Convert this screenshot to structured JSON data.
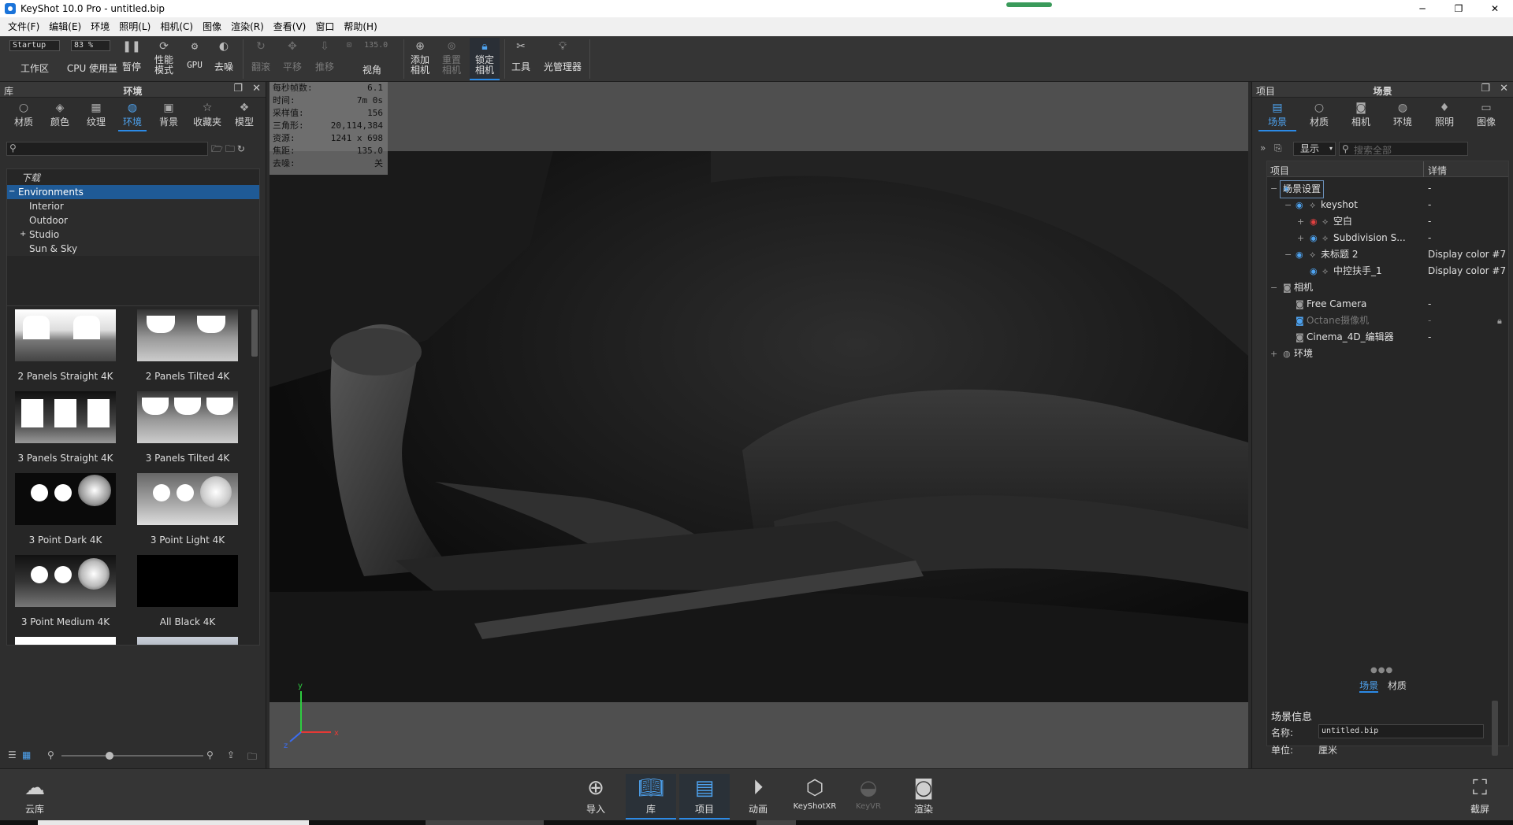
{
  "titlebar": {
    "title": "KeyShot 10.0 Pro  - untitled.bip",
    "minimize": "─",
    "maximize": "❐",
    "close": "✕"
  },
  "menu": [
    "文件(F)",
    "编辑(E)",
    "环境",
    "照明(L)",
    "相机(C)",
    "图像",
    "渲染(R)",
    "查看(V)",
    "窗口",
    "帮助(H)"
  ],
  "ribbon": {
    "workspace_select": "Startup",
    "workspace_label": "工作区",
    "cpu_select": "83 %",
    "cpu_label": "CPU 使用量",
    "pause": "暂停",
    "perf_mode": "性能模式",
    "gpu": "GPU",
    "denoise": "去噪",
    "tumble": "翻滚",
    "pan": "平移",
    "dolly": "推移",
    "fov_value": "135.0",
    "fov_label": "视角",
    "add_camera": "添加相机",
    "reset_camera": "重置相机",
    "lock_camera": "锁定相机",
    "tools": "工具",
    "light_manager": "光管理器"
  },
  "library": {
    "panel_label": "库",
    "panel_title": "环境",
    "tabs": [
      {
        "label": "材质",
        "icon": "material-icon"
      },
      {
        "label": "颜色",
        "icon": "color-icon"
      },
      {
        "label": "纹理",
        "icon": "texture-icon"
      },
      {
        "label": "环境",
        "icon": "environment-icon"
      },
      {
        "label": "背景",
        "icon": "background-icon"
      },
      {
        "label": "收藏夹",
        "icon": "favorites-icon"
      },
      {
        "label": "模型",
        "icon": "model-icon"
      }
    ],
    "tree": [
      {
        "label": "下载"
      },
      {
        "label": "Environments"
      },
      {
        "label": "Interior"
      },
      {
        "label": "Outdoor"
      },
      {
        "label": "Studio"
      },
      {
        "label": "Sun & Sky"
      }
    ],
    "thumbnails": [
      "2 Panels Straight 4K",
      "2 Panels Tilted 4K",
      "3 Panels Straight 4K",
      "3 Panels Tilted 4K",
      "3 Point Dark 4K",
      "3 Point Light 4K",
      "3 Point Medium 4K",
      "All Black 4K"
    ]
  },
  "hud": {
    "fps_label": "每秒帧数:",
    "fps": "6.1",
    "time_label": "时间:",
    "time": "7m 0s",
    "samples_label": "采样值:",
    "samples": "156",
    "tris_label": "三角形:",
    "tris": "20,114,384",
    "res_label": "资源:",
    "res": "1241 x 698",
    "focal_label": "焦距:",
    "focal": "135.0",
    "denoise_label": "去噪:",
    "denoise": "关"
  },
  "project": {
    "panel_label": "项目",
    "panel_title": "场景",
    "tabs": [
      {
        "label": "场景",
        "icon": "scene-icon"
      },
      {
        "label": "材质",
        "icon": "material-icon"
      },
      {
        "label": "相机",
        "icon": "camera-icon"
      },
      {
        "label": "环境",
        "icon": "environment-icon"
      },
      {
        "label": "照明",
        "icon": "lighting-icon"
      },
      {
        "label": "图像",
        "icon": "image-icon"
      }
    ],
    "display_label": "显示",
    "search_placeholder": "搜索全部",
    "col_item": "项目",
    "col_detail": "详情",
    "rows": [
      {
        "name": "场景设置",
        "detail": "-"
      },
      {
        "name": "keyshot",
        "detail": "-"
      },
      {
        "name": "空白",
        "detail": "-"
      },
      {
        "name": "Subdivision S...",
        "detail": "-"
      },
      {
        "name": "未标题 2",
        "detail": "Display color #7"
      },
      {
        "name": "中控扶手_1",
        "detail": "Display color #7"
      },
      {
        "name": "相机",
        "detail": ""
      },
      {
        "name": "Free Camera",
        "detail": "-"
      },
      {
        "name": "Octane摄像机",
        "detail": "-"
      },
      {
        "name": "Cinema_4D_编辑器",
        "detail": "-"
      },
      {
        "name": "环境",
        "detail": ""
      }
    ],
    "bottom_tabs": [
      "场景",
      "材质"
    ],
    "info_header": "场景信息",
    "name_label": "名称:",
    "name_value": "untitled.bip",
    "unit_label": "单位:",
    "unit_value": "厘米"
  },
  "bottombar": {
    "cloud": "云库",
    "import": "导入",
    "library": "库",
    "project": "项目",
    "animation": "动画",
    "keyshotxr": "KeyShotXR",
    "keyvr": "KeyVR",
    "render": "渲染",
    "screenshot": "截屏"
  },
  "axis": {
    "y": "y",
    "z": "z",
    "x": "x"
  }
}
